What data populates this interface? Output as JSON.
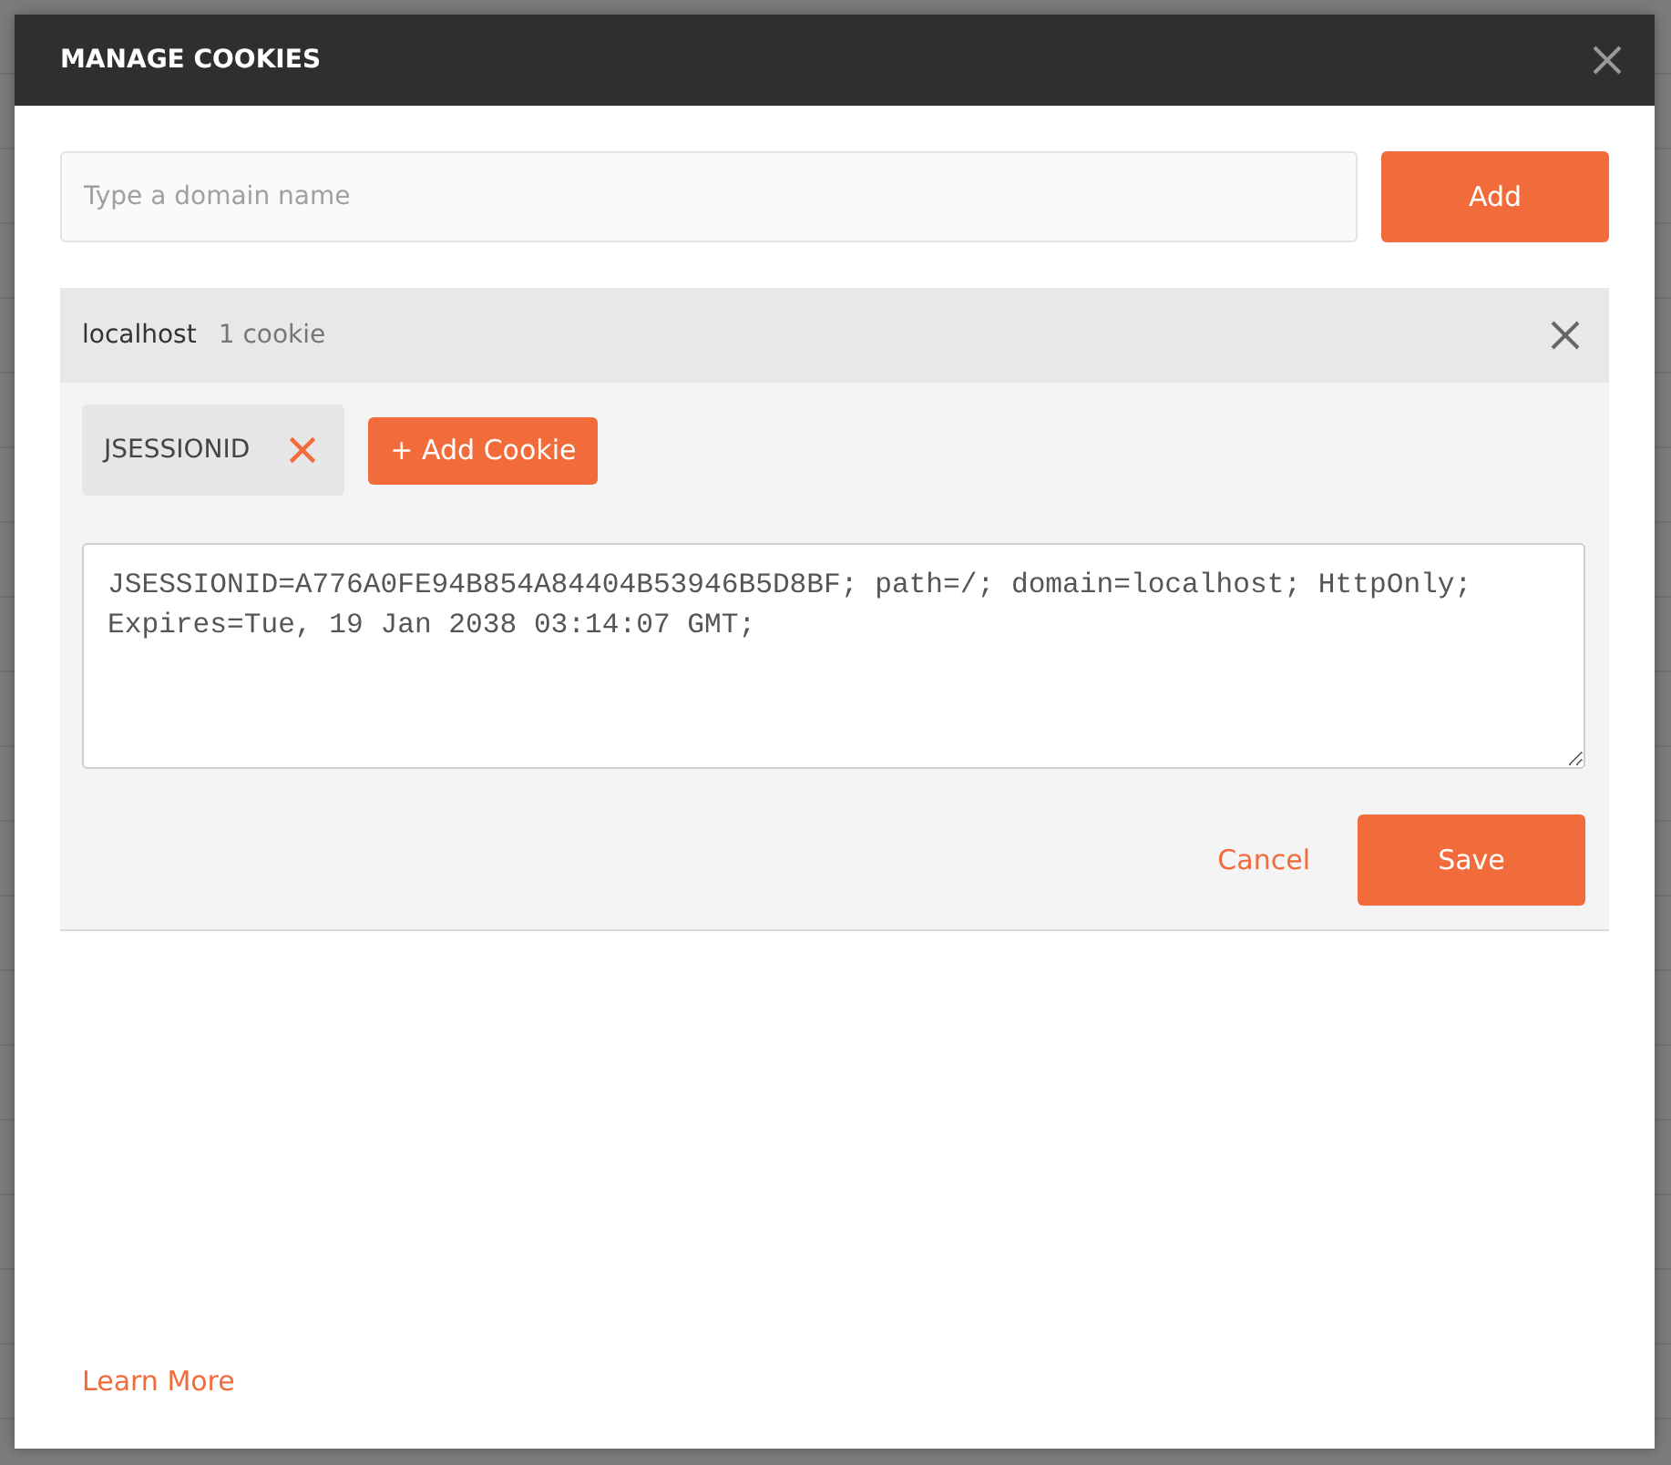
{
  "dialog": {
    "title": "MANAGE COOKIES"
  },
  "domain_field": {
    "placeholder": "Type a domain name"
  },
  "add_button": "Add",
  "domains": [
    {
      "name": "localhost",
      "count": "1 cookie",
      "cookies": [
        {
          "name": "JSESSIONID",
          "selected": true
        }
      ],
      "add_cookie_button": "+ Add Cookie",
      "cookie_text": "JSESSIONID=A776A0FE94B854A84404B53946B5D8BF; path=/; domain=localhost; HttpOnly; Expires=Tue, 19 Jan 2038 03:14:07 GMT;",
      "cancel_button": "Cancel",
      "save_button": "Save"
    }
  ],
  "learn_more_link": "Learn More"
}
